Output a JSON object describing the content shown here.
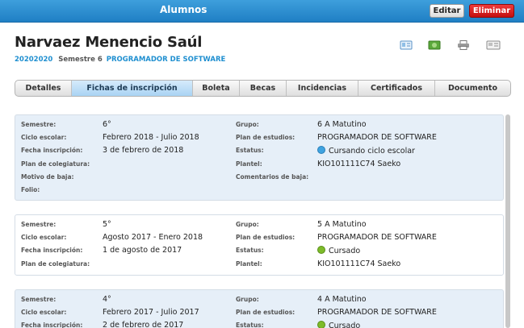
{
  "topbar": {
    "title": "Alumnos",
    "edit_label": "Editar",
    "delete_label": "Eliminar"
  },
  "student": {
    "name": "Narvaez Menencio Saúl",
    "matricula": "20202020",
    "semester": "Semestre 6",
    "program": "PROGRAMADOR DE SOFTWARE"
  },
  "icons": [
    "id-card-icon",
    "money-icon",
    "print-icon",
    "card-icon"
  ],
  "tabs": [
    {
      "label": "Detalles",
      "active": false
    },
    {
      "label": "Fichas de inscripción",
      "active": true
    },
    {
      "label": "Boleta",
      "active": false
    },
    {
      "label": "Becas",
      "active": false
    },
    {
      "label": "Incidencias",
      "active": false
    },
    {
      "label": "Certificados",
      "active": false
    },
    {
      "label": "Documento",
      "active": false
    }
  ],
  "labels": {
    "semestre": "Semestre:",
    "ciclo": "Ciclo escolar:",
    "fecha": "Fecha inscripción:",
    "colegiatura": "Plan de colegiatura:",
    "motivo": "Motivo de baja:",
    "folio": "Folio:",
    "grupo": "Grupo:",
    "plan": "Plan de estudios:",
    "estatus": "Estatus:",
    "plantel": "Plantel:",
    "comentarios": "Comentarios de baja:"
  },
  "status_colors": {
    "current": "#3fa3e0",
    "done": "#7dbb2a"
  },
  "records": [
    {
      "semestre": "6°",
      "ciclo": "Febrero 2018 - Julio 2018",
      "fecha": "3 de febrero de 2018",
      "grupo": "6 A Matutino",
      "plan": "PROGRAMADOR DE SOFTWARE",
      "estatus": "Cursando ciclo escolar",
      "estatus_kind": "current",
      "plantel": "KIO101111C74 Saeko"
    },
    {
      "semestre": "5°",
      "ciclo": "Agosto 2017 - Enero 2018",
      "fecha": "1 de agosto de 2017",
      "grupo": "5 A  Matutino",
      "plan": "PROGRAMADOR DE SOFTWARE",
      "estatus": "Cursado",
      "estatus_kind": "done",
      "plantel": "KIO101111C74 Saeko"
    },
    {
      "semestre": "4°",
      "ciclo": "Febrero 2017 - Julio 2017",
      "fecha": "2 de febrero de 2017",
      "grupo": "4 A  Matutino",
      "plan": "PROGRAMADOR DE SOFTWARE",
      "estatus": "Cursado",
      "estatus_kind": "done"
    }
  ]
}
